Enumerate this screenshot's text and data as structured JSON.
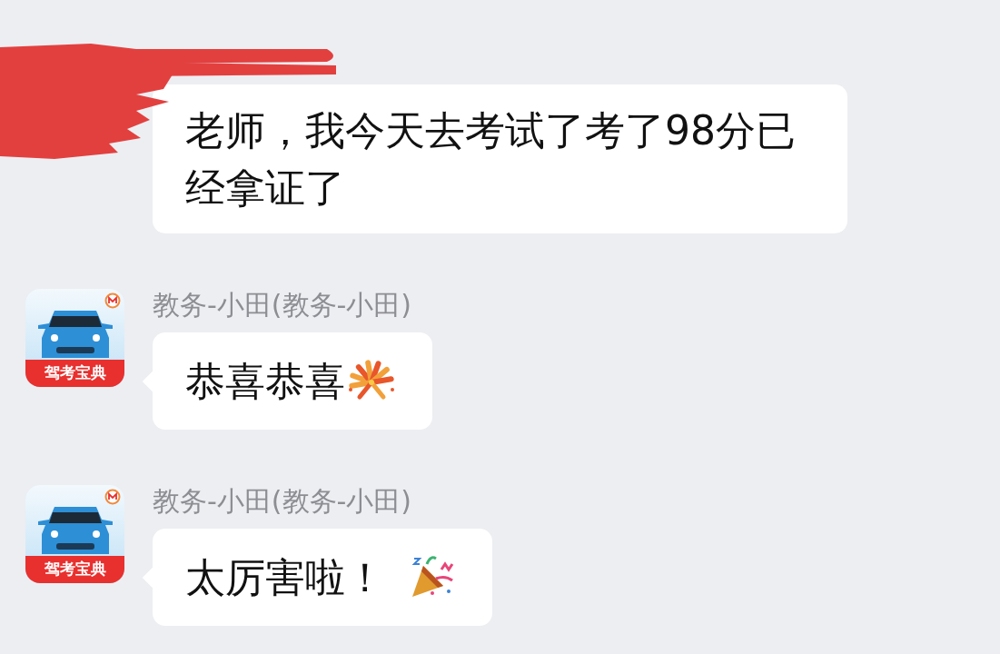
{
  "messages": [
    {
      "sender": {
        "redacted": true
      },
      "text": "老师，我今天去考试了考了98分已经拿证了"
    },
    {
      "sender": {
        "redacted": false,
        "name": "教务-小田(教务-小田)",
        "avatar_label": "驾考宝典"
      },
      "text": "恭喜恭喜",
      "kind": "fireworks"
    },
    {
      "sender": {
        "redacted": false,
        "name": "教务-小田(教务-小田)",
        "avatar_label": "驾考宝典"
      },
      "text": "太厉害啦！",
      "kind": "popper"
    }
  ]
}
